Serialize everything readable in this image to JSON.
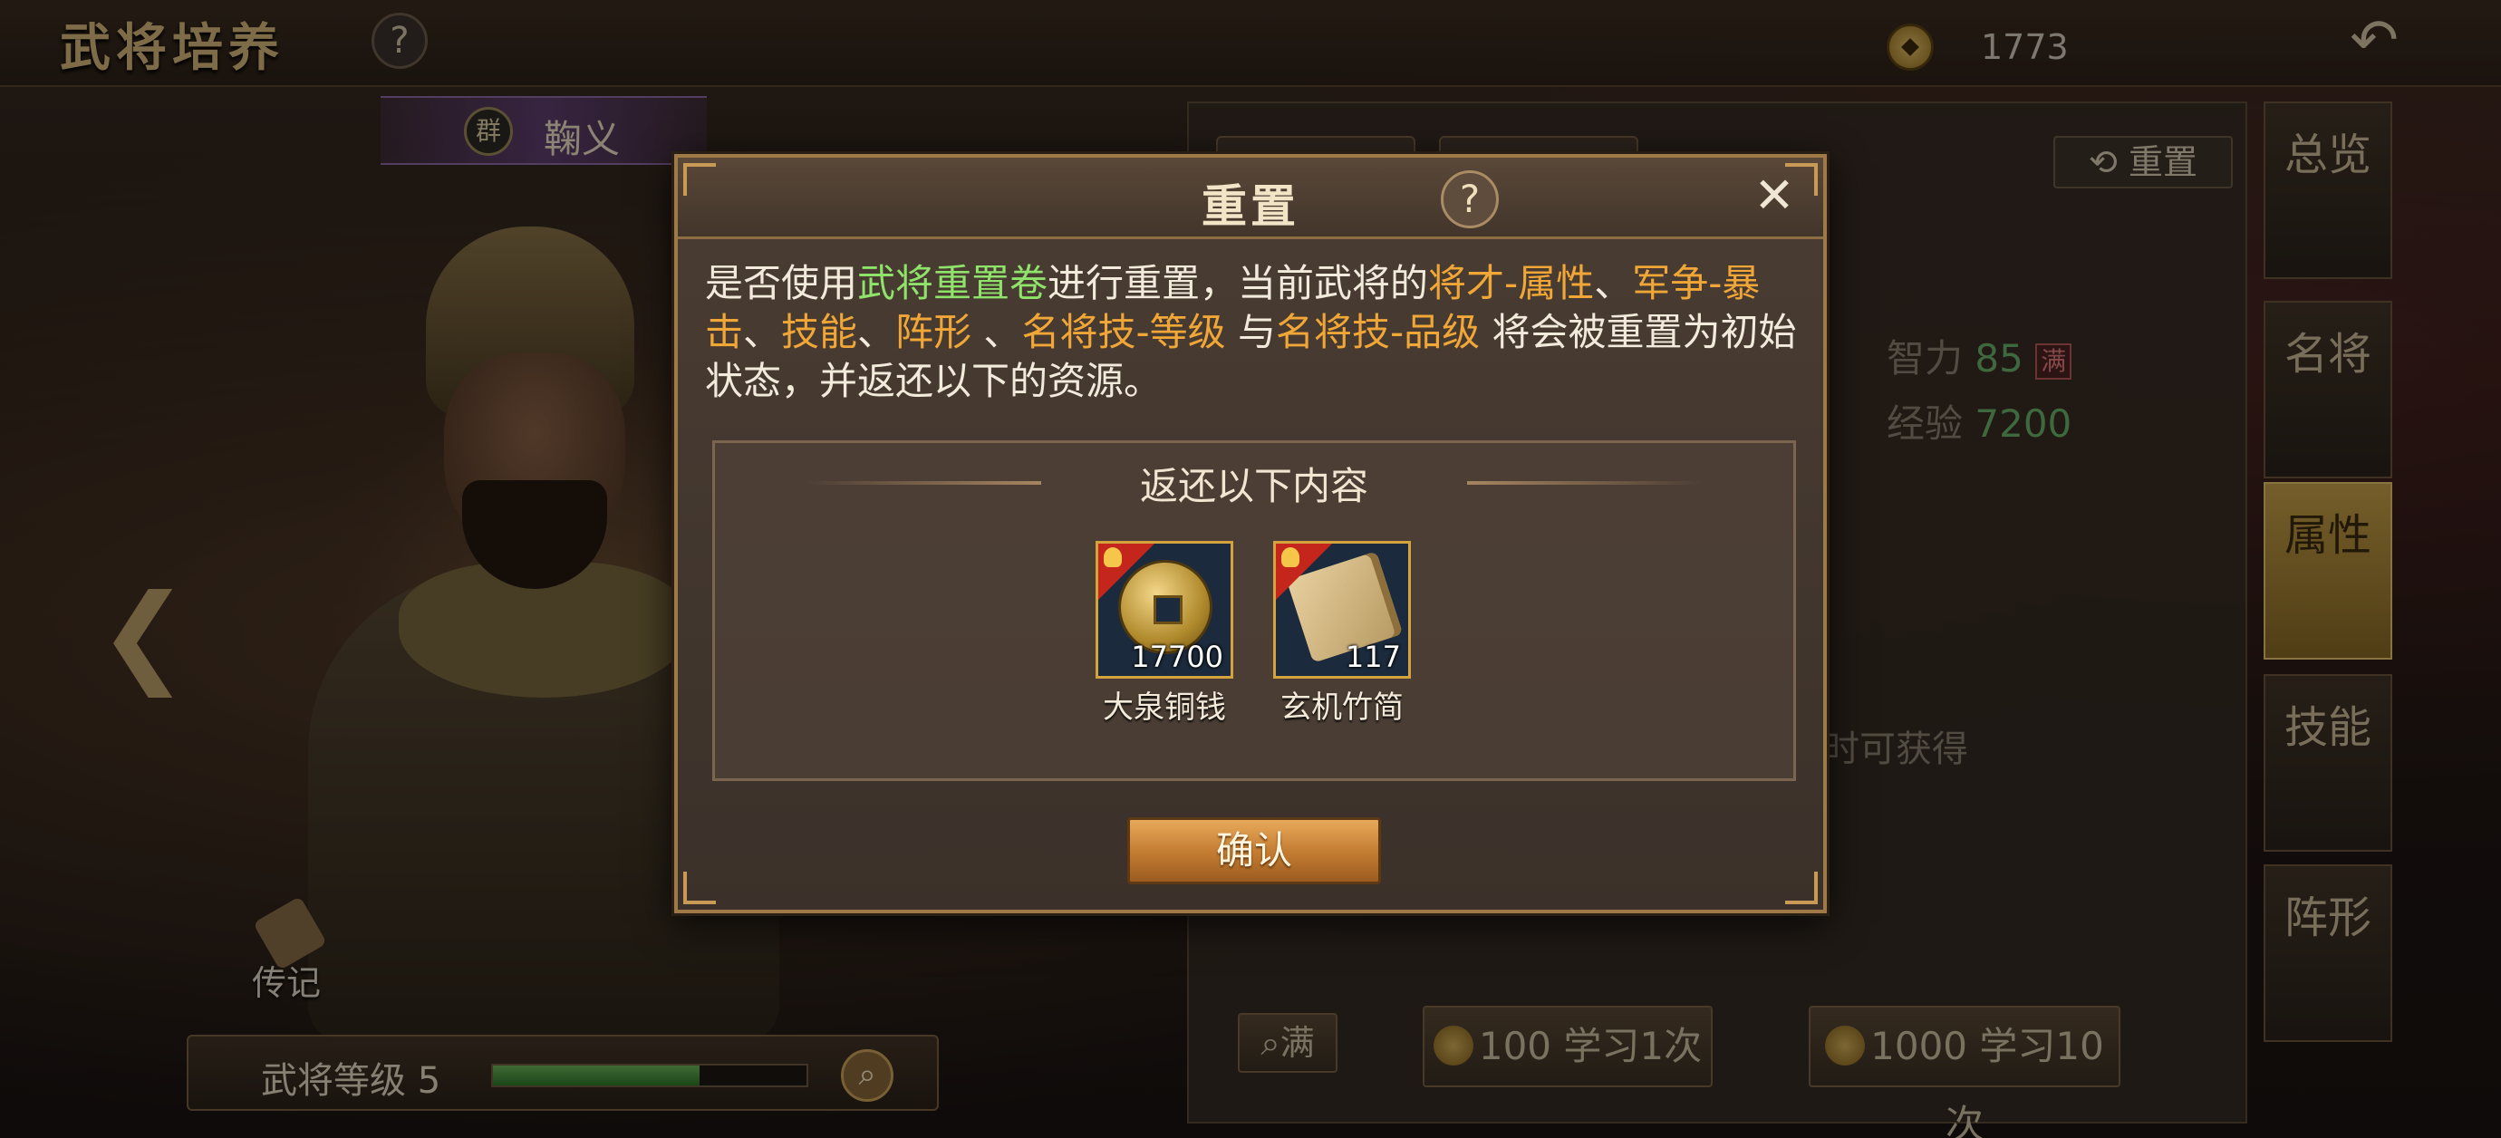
{
  "top_bar": {
    "title": "武将培养",
    "help_icon": "?",
    "currency_icon": "coin-icon",
    "currency_value": "1773",
    "back_icon": "↶"
  },
  "general": {
    "faction": "群",
    "name": "鞠义",
    "biography_label": "传记",
    "level_label": "武将等级 5",
    "level_progress": 0.66,
    "prev_arrow": "❮"
  },
  "right_panel": {
    "reset_label": "⟲ 重置",
    "stats": [
      {
        "label": "智力",
        "value": "85",
        "tag": "满"
      },
      {
        "label": "经验",
        "value": "7200"
      }
    ],
    "obtain_text": "时可获得",
    "full_search_label": "满",
    "learn_once": {
      "cost": "100",
      "label": "学习1次"
    },
    "learn_ten": {
      "cost": "1000",
      "label": "学习10次"
    }
  },
  "side_tabs": [
    {
      "label": "总览",
      "active": false
    },
    {
      "label": "名将",
      "active": false
    },
    {
      "label": "属性",
      "active": true
    },
    {
      "label": "技能",
      "active": false
    },
    {
      "label": "阵形",
      "active": false
    }
  ],
  "modal": {
    "title": "重置",
    "help_icon": "?",
    "close_icon": "✕",
    "message_parts": {
      "p1": "是否使用",
      "item": "武将重置卷",
      "p2": "进行重置，当前武将的",
      "t1": "将才-属性",
      "s1": "、",
      "t2": "军争-暴击",
      "s2": "、",
      "t3": "技能",
      "s3": "、",
      "t4": "阵形",
      "s4": " 、",
      "t5": "名将技-等级",
      "s5": " 与",
      "t6": "名将技-品级",
      "p3": " 将会被重置为初始状态，并返还以下的资源。"
    },
    "reward_title": "返还以下内容",
    "rewards": [
      {
        "name": "大泉铜钱",
        "count": "17700",
        "icon": "coin-icon"
      },
      {
        "name": "玄机竹简",
        "count": "117",
        "icon": "scroll-icon"
      }
    ],
    "confirm_label": "确认"
  },
  "colors": {
    "highlight_green": "#8fe26a",
    "highlight_gold": "#f1a737",
    "active_tab": "#c9a24a",
    "confirm_button": "#c17a30"
  }
}
